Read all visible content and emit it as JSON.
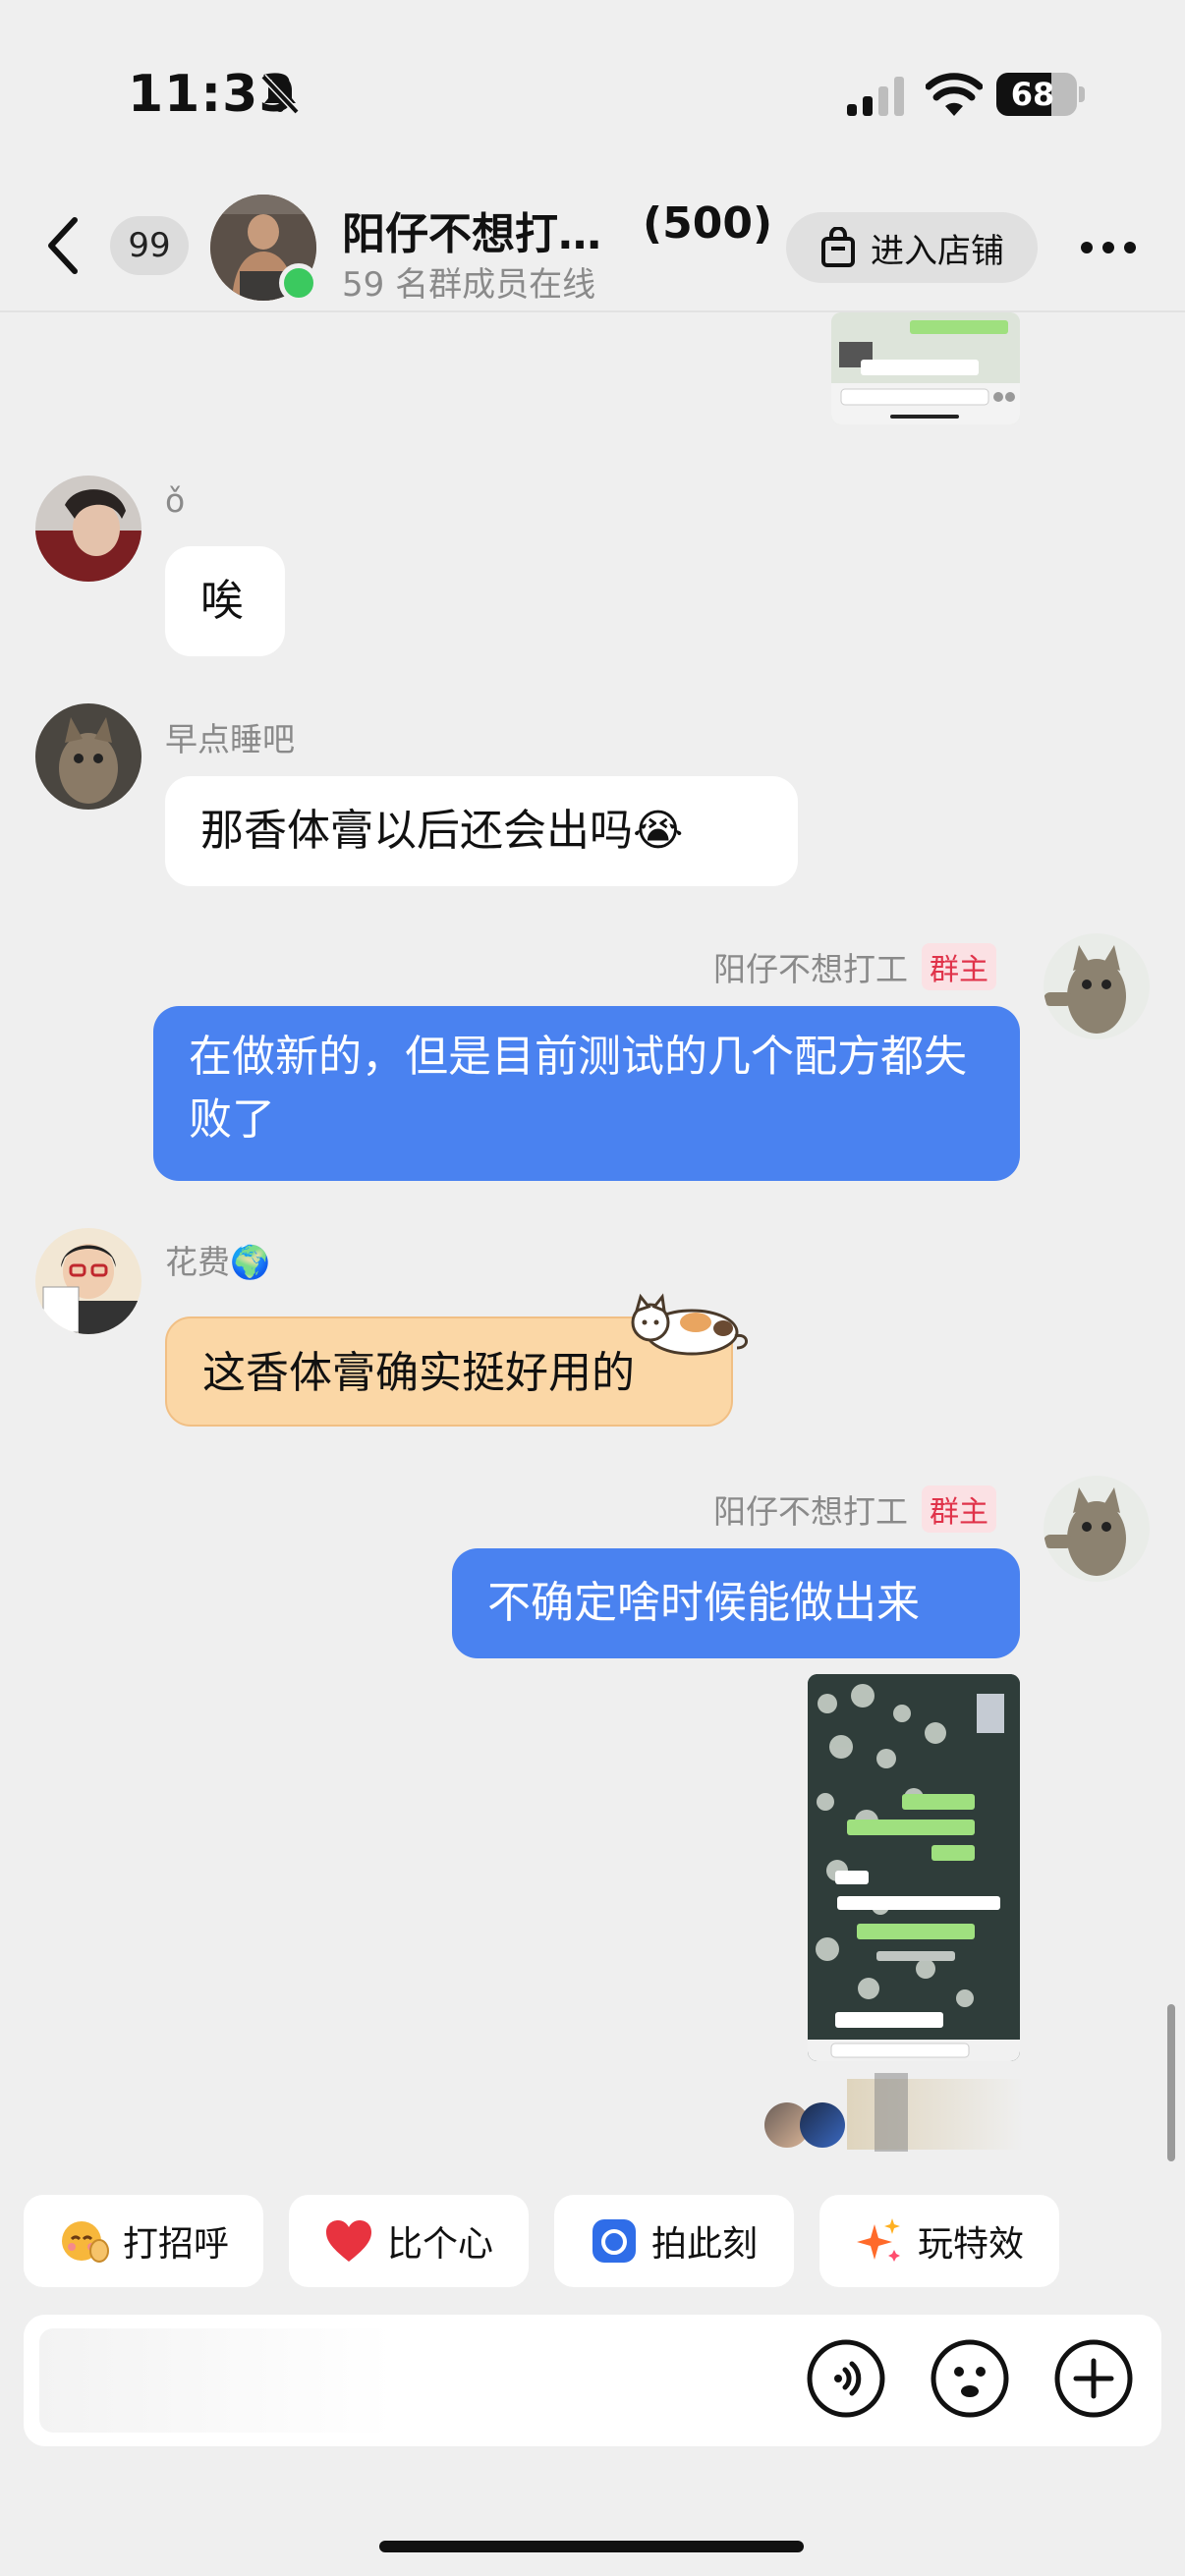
{
  "status_bar": {
    "time": "11:33",
    "battery": "68"
  },
  "header": {
    "unread_count": "99",
    "title": "阳仔不想打…",
    "member_total": "(500)",
    "subtitle": "59 名群成员在线",
    "shop_label": "进入店铺"
  },
  "messages": [
    {
      "sender": "ǒ",
      "text": "唉"
    },
    {
      "sender": "早点睡吧",
      "text": "那香体膏以后还会出吗😭"
    },
    {
      "sender": "阳仔不想打工",
      "tag": "群主",
      "text": "在做新的，但是目前测试的几个配方都失败了"
    },
    {
      "sender": "花费🌍",
      "text": "这香体膏确实挺好用的"
    },
    {
      "sender": "阳仔不想打工",
      "tag": "群主",
      "text": "不确定啥时候能做出来"
    }
  ],
  "quick_actions": [
    {
      "label": "打招呼",
      "icon": "wave-emoji-icon"
    },
    {
      "label": "比个心",
      "icon": "heart-icon"
    },
    {
      "label": "拍此刻",
      "icon": "camera-icon"
    },
    {
      "label": "玩特效",
      "icon": "sparkle-icon"
    }
  ],
  "colors": {
    "background": "#efefef",
    "outgoing_bubble": "#4a82f0",
    "incoming_bubble": "#ffffff",
    "special_bubble": "#fbd7a6",
    "owner_tag_text": "#e0334a",
    "online": "#3bc95f"
  }
}
